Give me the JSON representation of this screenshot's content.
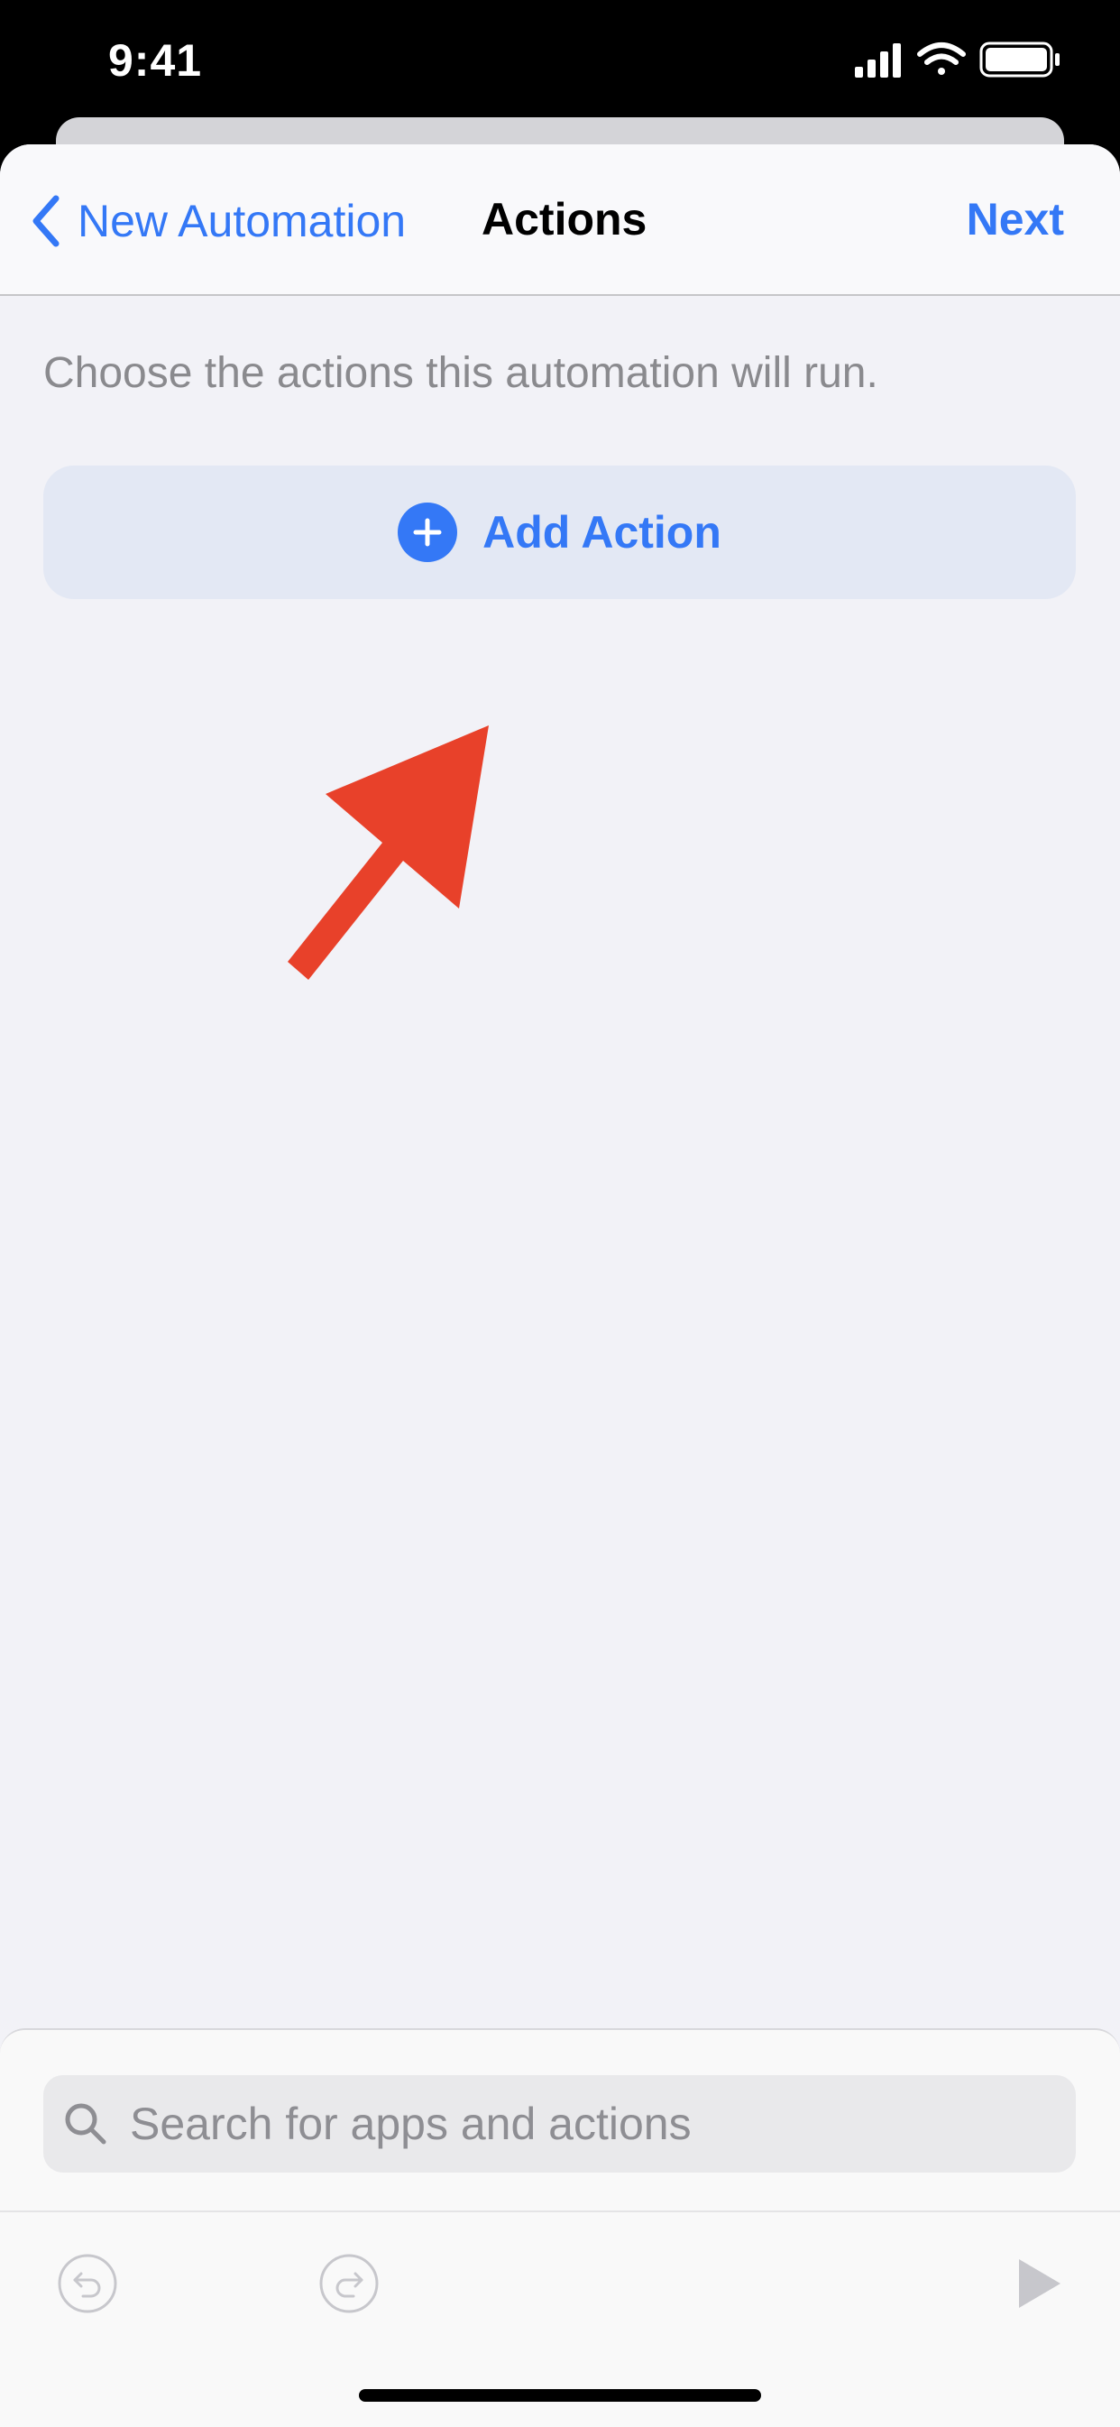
{
  "status_bar": {
    "time": "9:41"
  },
  "nav": {
    "back_label": "New Automation",
    "title": "Actions",
    "next_label": "Next"
  },
  "content": {
    "description": "Choose the actions this automation will run.",
    "add_action_label": "Add Action"
  },
  "search": {
    "placeholder": "Search for apps and actions",
    "value": ""
  },
  "toolbar": {
    "icons": [
      "undo-icon",
      "redo-icon",
      "play-icon"
    ]
  },
  "colors": {
    "accent": "#3478f6",
    "background": "#f2f2f7",
    "annotation_arrow": "#e8412a"
  }
}
